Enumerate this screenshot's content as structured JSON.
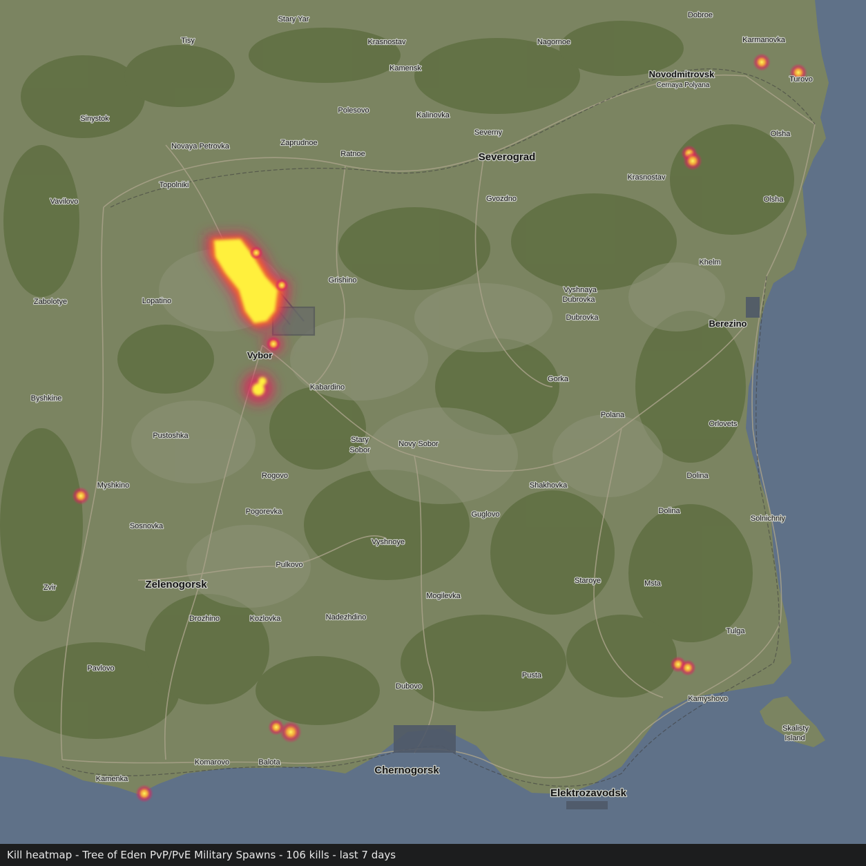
{
  "caption": "Kill heatmap - Tree of Eden PvP/PvE Military Spawns - 106 kills - last 7 days",
  "colors": {
    "sea": "#5f7188",
    "land": "#7b8461",
    "forest": "#5f6e42",
    "road": "#a9a28a",
    "heat_cool": "#e0245c",
    "heat_warm": "#f26a2e",
    "heat_hot": "#fff03c",
    "footer_bg": "#1c1d1e"
  },
  "labels": [
    {
      "text": "Dobroe",
      "kind": "town"
    },
    {
      "text": "Stary Yar",
      "kind": "town"
    },
    {
      "text": "Tisy",
      "kind": "town"
    },
    {
      "text": "Krasnostav",
      "kind": "town"
    },
    {
      "text": "Karmanovka",
      "kind": "town"
    },
    {
      "text": "Nagornoe",
      "kind": "town"
    },
    {
      "text": "Kamensk",
      "kind": "town"
    },
    {
      "text": "Novodmitrovsk",
      "kind": "city-mid"
    },
    {
      "text": "Cernaya Polyana",
      "kind": "small"
    },
    {
      "text": "Turovo",
      "kind": "town"
    },
    {
      "text": "Sinystok",
      "kind": "town"
    },
    {
      "text": "Polesovo",
      "kind": "town"
    },
    {
      "text": "Kalinovka",
      "kind": "town"
    },
    {
      "text": "Severny",
      "kind": "town"
    },
    {
      "text": "Olsha",
      "kind": "town"
    },
    {
      "text": "Novaya Petrovka",
      "kind": "town"
    },
    {
      "text": "Zaprudnoe",
      "kind": "town"
    },
    {
      "text": "Ratnoe",
      "kind": "town"
    },
    {
      "text": "Severograd",
      "kind": "city"
    },
    {
      "text": "Krasnostav",
      "kind": "town"
    },
    {
      "text": "Topolniki",
      "kind": "town"
    },
    {
      "text": "Vavilovo",
      "kind": "town"
    },
    {
      "text": "Gvozdno",
      "kind": "town"
    },
    {
      "text": "Olsha",
      "kind": "town"
    },
    {
      "text": "Khelm",
      "kind": "town"
    },
    {
      "text": "Grishino",
      "kind": "town"
    },
    {
      "text": "Vyshnaya",
      "kind": "town"
    },
    {
      "text": "Dubrovka",
      "kind": "town"
    },
    {
      "text": "Zabolotye",
      "kind": "town"
    },
    {
      "text": "Lopatino",
      "kind": "town"
    },
    {
      "text": "Dubrovka",
      "kind": "town"
    },
    {
      "text": "Berezino",
      "kind": "city-mid"
    },
    {
      "text": "Vybor",
      "kind": "city-mid"
    },
    {
      "text": "Kabardino",
      "kind": "town"
    },
    {
      "text": "Gorka",
      "kind": "town"
    },
    {
      "text": "Byshkine",
      "kind": "town"
    },
    {
      "text": "Polana",
      "kind": "town"
    },
    {
      "text": "Orlovets",
      "kind": "town"
    },
    {
      "text": "Pustoshka",
      "kind": "town"
    },
    {
      "text": "Stary",
      "kind": "town"
    },
    {
      "text": "Sobor",
      "kind": "town"
    },
    {
      "text": "Novy Sobor",
      "kind": "town"
    },
    {
      "text": "Rogovo",
      "kind": "town"
    },
    {
      "text": "Dolina",
      "kind": "town"
    },
    {
      "text": "Myshkino",
      "kind": "town"
    },
    {
      "text": "Shakhovka",
      "kind": "town"
    },
    {
      "text": "Pogorevka",
      "kind": "town"
    },
    {
      "text": "Guglovo",
      "kind": "town"
    },
    {
      "text": "Dolina",
      "kind": "town"
    },
    {
      "text": "Solnichniy",
      "kind": "town"
    },
    {
      "text": "Sosnovka",
      "kind": "town"
    },
    {
      "text": "Vyshnoye",
      "kind": "town"
    },
    {
      "text": "Pulkovo",
      "kind": "town"
    },
    {
      "text": "Zvir",
      "kind": "town"
    },
    {
      "text": "Zelenogorsk",
      "kind": "city"
    },
    {
      "text": "Staroye",
      "kind": "town"
    },
    {
      "text": "Msta",
      "kind": "town"
    },
    {
      "text": "Mogilevka",
      "kind": "town"
    },
    {
      "text": "Drozhino",
      "kind": "town"
    },
    {
      "text": "Kozlovka",
      "kind": "town"
    },
    {
      "text": "Nadezhdino",
      "kind": "town"
    },
    {
      "text": "Tulga",
      "kind": "town"
    },
    {
      "text": "Pavlovo",
      "kind": "town"
    },
    {
      "text": "Pusta",
      "kind": "town"
    },
    {
      "text": "Dubovo",
      "kind": "town"
    },
    {
      "text": "Kamyshovo",
      "kind": "town"
    },
    {
      "text": "Skalisty",
      "kind": "town"
    },
    {
      "text": "Island",
      "kind": "town"
    },
    {
      "text": "Komarovo",
      "kind": "town"
    },
    {
      "text": "Balota",
      "kind": "town"
    },
    {
      "text": "Chernogorsk",
      "kind": "city"
    },
    {
      "text": "Kamenka",
      "kind": "town"
    },
    {
      "text": "Elektrozavodsk",
      "kind": "city"
    }
  ]
}
